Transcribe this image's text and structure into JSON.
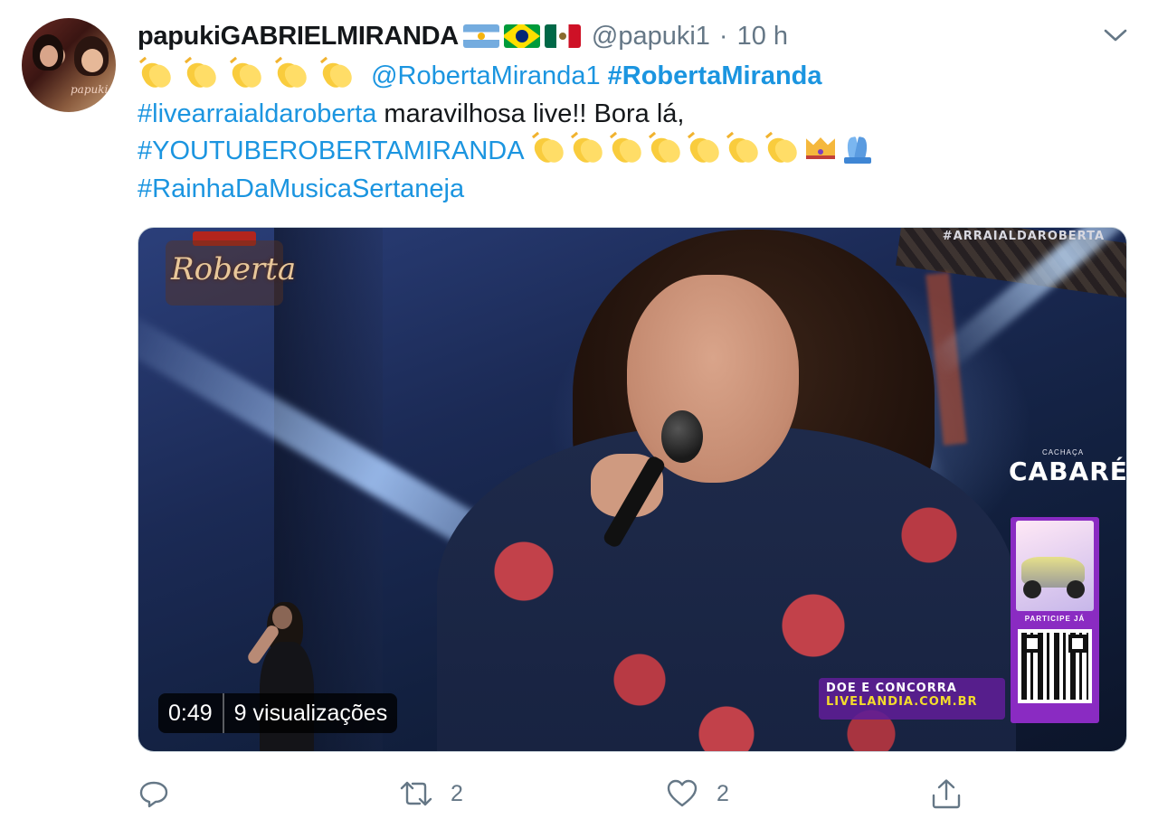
{
  "tweet": {
    "display_name": "papukiGABRIELMIRANDA",
    "name_flags": [
      "flag-argentina",
      "flag-brazil",
      "flag-mexico"
    ],
    "handle": "@papuki1",
    "separator": "·",
    "time": "10 h",
    "avatar_label": "papuki",
    "menu_icon": "chevron-down-icon",
    "text": {
      "line1": {
        "mention": "@RobertaMiranda1",
        "hashtag": "#RobertaMiranda"
      },
      "line2": {
        "hashtag": "#livearraialdaroberta",
        "text": " maravilhosa live!! Bora lá,"
      },
      "line3": {
        "hashtag": "#YOUTUBEROBERTAMIRANDA"
      },
      "line4": {
        "hashtag": "#RainhaDaMusicaSertaneja"
      }
    },
    "emoji": [
      "clapping-hands-emoji",
      "crown-emoji",
      "folded-hands-emoji"
    ]
  },
  "video": {
    "duration": "0:49",
    "views": "9 visualizações",
    "overlays": {
      "corner_hashtag": "#ARRAIALDAROBERTA",
      "logo_script": "Roberta",
      "sponsor_small": "CACHAÇA",
      "sponsor_name": "CABARÉ",
      "promo_cta": "PARTICIPE JÁ",
      "banner_line1": "DOE E CONCORRA",
      "banner_line2": "LIVELANDIA.COM.BR"
    }
  },
  "actions": {
    "reply": {
      "icon": "reply-icon",
      "count": ""
    },
    "retweet": {
      "icon": "retweet-icon",
      "count": "2"
    },
    "like": {
      "icon": "heart-icon",
      "count": "2"
    },
    "share": {
      "icon": "share-icon",
      "count": ""
    }
  },
  "colors": {
    "link": "#1b95e0",
    "text": "#14171a",
    "muted": "#657786"
  }
}
